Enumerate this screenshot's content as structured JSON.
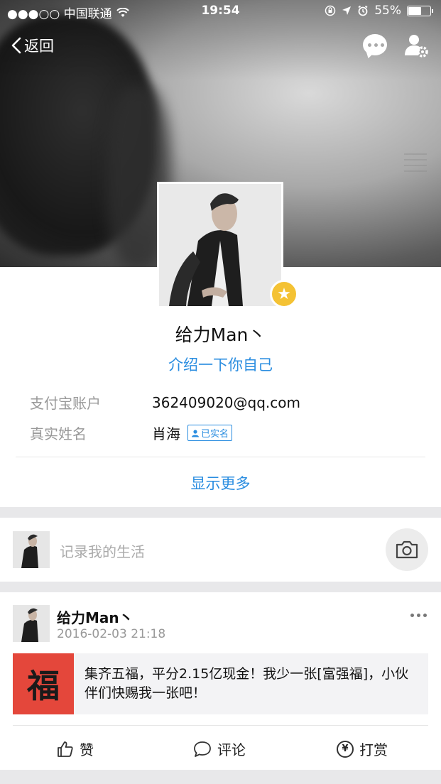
{
  "status_bar": {
    "carrier": "●●●○○ 中国联通",
    "time": "19:54",
    "battery": "55%",
    "battery_level": 0.55
  },
  "nav": {
    "back_label": "返回",
    "icons": [
      "chat-bubble-icon",
      "user-settings-icon"
    ]
  },
  "profile": {
    "nickname": "给力Man丶",
    "intro_link": "介绍一下你自己",
    "fields": [
      {
        "label": "支付宝账户",
        "value": "362409020@qq.com"
      },
      {
        "label": "真实姓名",
        "value": "肖海",
        "badge": "已实名"
      }
    ],
    "show_more": "显示更多"
  },
  "composer": {
    "placeholder": "记录我的生活"
  },
  "feed": {
    "author": "给力Man丶",
    "time": "2016-02-03 21:18",
    "share_image_text": "福",
    "share_text": "集齐五福，平分2.15亿现金！我少一张[富强福]，小伙伴们快赐我一张吧！",
    "actions": {
      "like": "赞",
      "comment": "评论",
      "reward": "打赏",
      "reward_symbol": "¥"
    }
  },
  "colors": {
    "accent": "#2a8de0",
    "badge_gold": "#f4c234",
    "fu_red": "#e4473b"
  }
}
